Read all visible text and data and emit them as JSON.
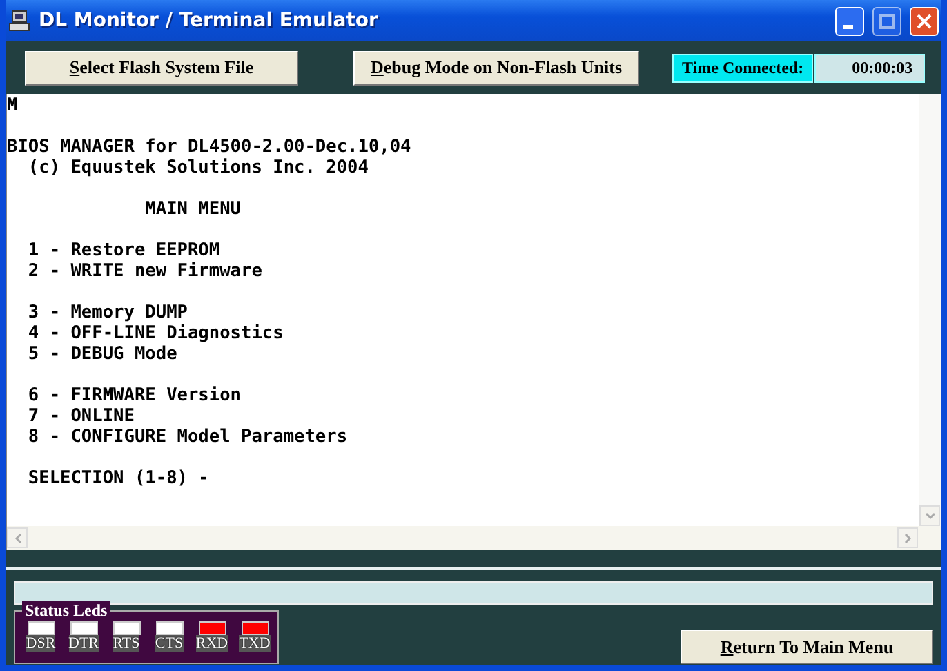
{
  "window": {
    "title": "DL Monitor / Terminal Emulator"
  },
  "toolbar": {
    "buttons": [
      "Select Flash System File",
      "Debug Mode on Non-Flash Units"
    ],
    "time_label": "Time Connected:",
    "time_value": "00:00:03"
  },
  "terminal": {
    "blocks": [
      [
        "M"
      ],
      [
        "BIOS MANAGER for DL4500-2.00-Dec.10,04",
        "  (c) Equustek Solutions Inc. 2004"
      ],
      [
        "             MAIN MENU"
      ],
      [
        "  1 - Restore EEPROM",
        "  2 - WRITE new Firmware"
      ],
      [
        "  3 - Memory DUMP",
        "  4 - OFF-LINE Diagnostics",
        "  5 - DEBUG Mode"
      ],
      [
        "  6 - FIRMWARE Version",
        "  7 - ONLINE",
        "  8 - CONFIGURE Model Parameters"
      ],
      [
        "  SELECTION (1-8) -"
      ]
    ]
  },
  "status_leds": {
    "title": "Status Leds",
    "leds": [
      {
        "label": "DSR",
        "lit": false
      },
      {
        "label": "DTR",
        "lit": false
      },
      {
        "label": "RTS",
        "lit": false
      },
      {
        "label": "CTS",
        "lit": false
      },
      {
        "label": "RXD",
        "lit": true
      },
      {
        "label": "TXD",
        "lit": true
      }
    ]
  },
  "progress": {
    "level": 0
  },
  "return_button": "Return To Main Menu"
}
